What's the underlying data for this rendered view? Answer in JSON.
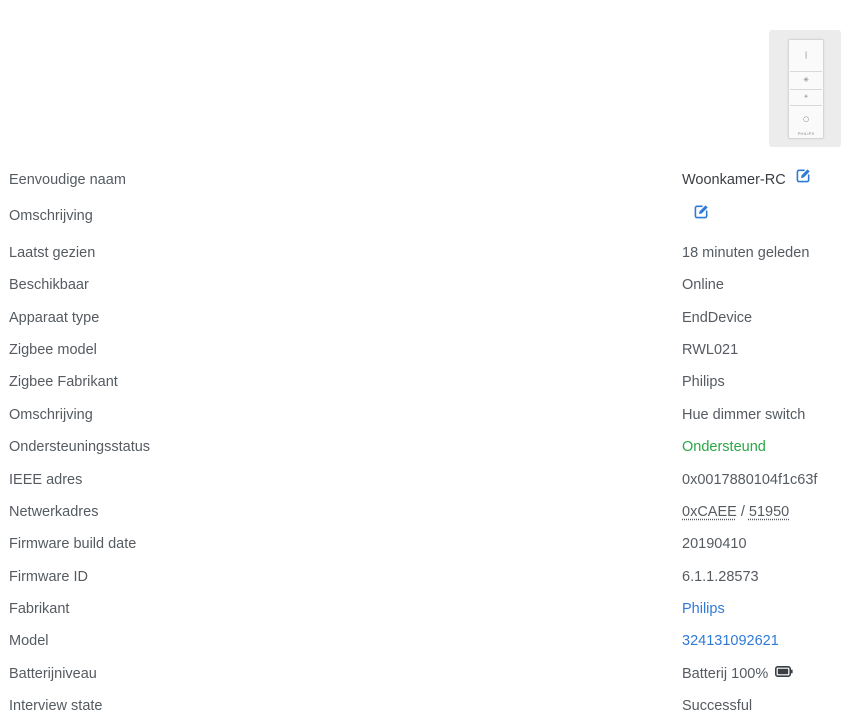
{
  "image": {
    "alt_icon": "hue-dimmer-remote-image",
    "brand_text": "PHILIPS"
  },
  "rows": [
    {
      "label": "Eenvoudige naam",
      "value": "Woonkamer-RC"
    },
    {
      "label": "Omschrijving",
      "value": ""
    },
    {
      "label": "Laatst gezien",
      "value": "18 minuten geleden"
    },
    {
      "label": "Beschikbaar",
      "value": "Online"
    },
    {
      "label": "Apparaat type",
      "value": "EndDevice"
    },
    {
      "label": "Zigbee model",
      "value": "RWL021"
    },
    {
      "label": "Zigbee Fabrikant",
      "value": "Philips"
    },
    {
      "label": "Omschrijving",
      "value": "Hue dimmer switch"
    },
    {
      "label": "Ondersteuningsstatus",
      "value": "Ondersteund"
    },
    {
      "label": "IEEE adres",
      "value": "0x0017880104f1c63f"
    },
    {
      "label": "Netwerkadres",
      "value_hex": "0xCAEE",
      "separator": " / ",
      "value_dec": "51950"
    },
    {
      "label": "Firmware build date",
      "value": "20190410"
    },
    {
      "label": "Firmware ID",
      "value": "6.1.1.28573"
    },
    {
      "label": "Fabrikant",
      "value": "Philips"
    },
    {
      "label": "Model",
      "value": "324131092621"
    },
    {
      "label": "Batterijniveau",
      "value": "Batterij 100%",
      "battery_level": 1.0
    },
    {
      "label": "Interview state",
      "value": "Successful"
    }
  ],
  "colors": {
    "text": "#555b61",
    "supported": "#28a745",
    "link": "#2f7ad8",
    "edit_icon": "#2f7ad8"
  }
}
